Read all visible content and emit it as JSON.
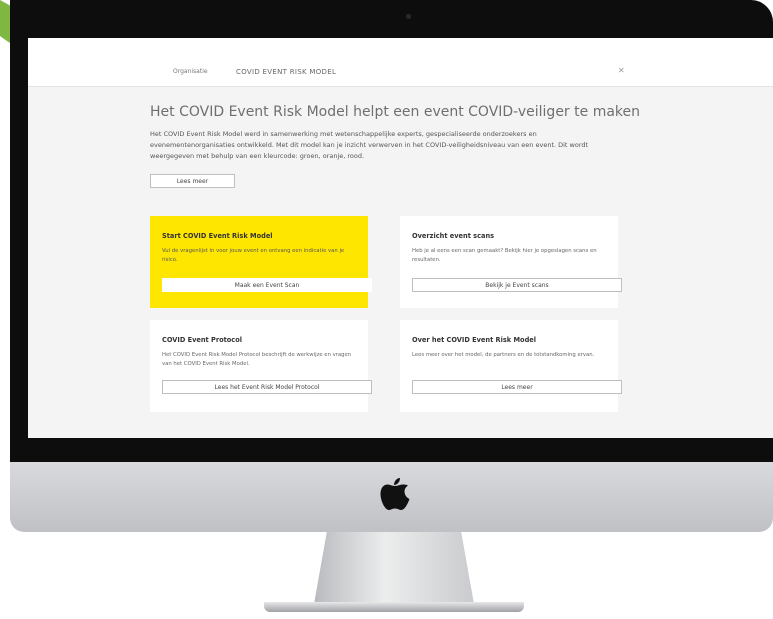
{
  "topbar": {
    "logo_text": "Organisatie",
    "nav_title": "COVID EVENT RISK MODEL",
    "menu_icon": "close-icon"
  },
  "main": {
    "heading": "Het COVID Event Risk Model helpt een event COVID-veiliger te maken",
    "intro": "Het COVID Event Risk Model werd in samenwerking met wetenschappelijke experts, gespecialiseerde onderzoekers en evenementenorganisaties ontwikkeld. Met dit model kan je inzicht verwerven in het COVID-veiligheidsniveau van een event. Dit wordt weergegeven met behulp van een kleurcode: groen, oranje, rood.",
    "lees_meer": "Lees meer"
  },
  "cards": [
    {
      "title": "Start COVID Event Risk Model",
      "desc": "Vul de vragenlijst in voor jouw event en ontvang een indicatie van je risico.",
      "button": "Maak een Event Scan"
    },
    {
      "title": "Overzicht event scans",
      "desc": "Heb je al eens een scan gemaakt? Bekijk hier je opgeslagen scans en resultaten.",
      "button": "Bekijk je Event scans"
    },
    {
      "title": "COVID Event Protocol",
      "desc": "Het COVID Event Risk Model Protocol beschrijft de werkwijze en vragen van het COVID Event Risk Model.",
      "button": "Lees het Event Risk Model Protocol"
    },
    {
      "title": "Over het COVID Event Risk Model",
      "desc": "Lees meer over het model, de partners en de totstandkoming ervan.",
      "button": "Lees meer"
    }
  ],
  "colors": {
    "accent_yellow": "#ffe600",
    "ring_green": "#7fb742",
    "ring_teal": "#1f5f6b",
    "bezel": "#0d0d0d"
  },
  "icons": {
    "apple": "apple-logo-icon"
  }
}
